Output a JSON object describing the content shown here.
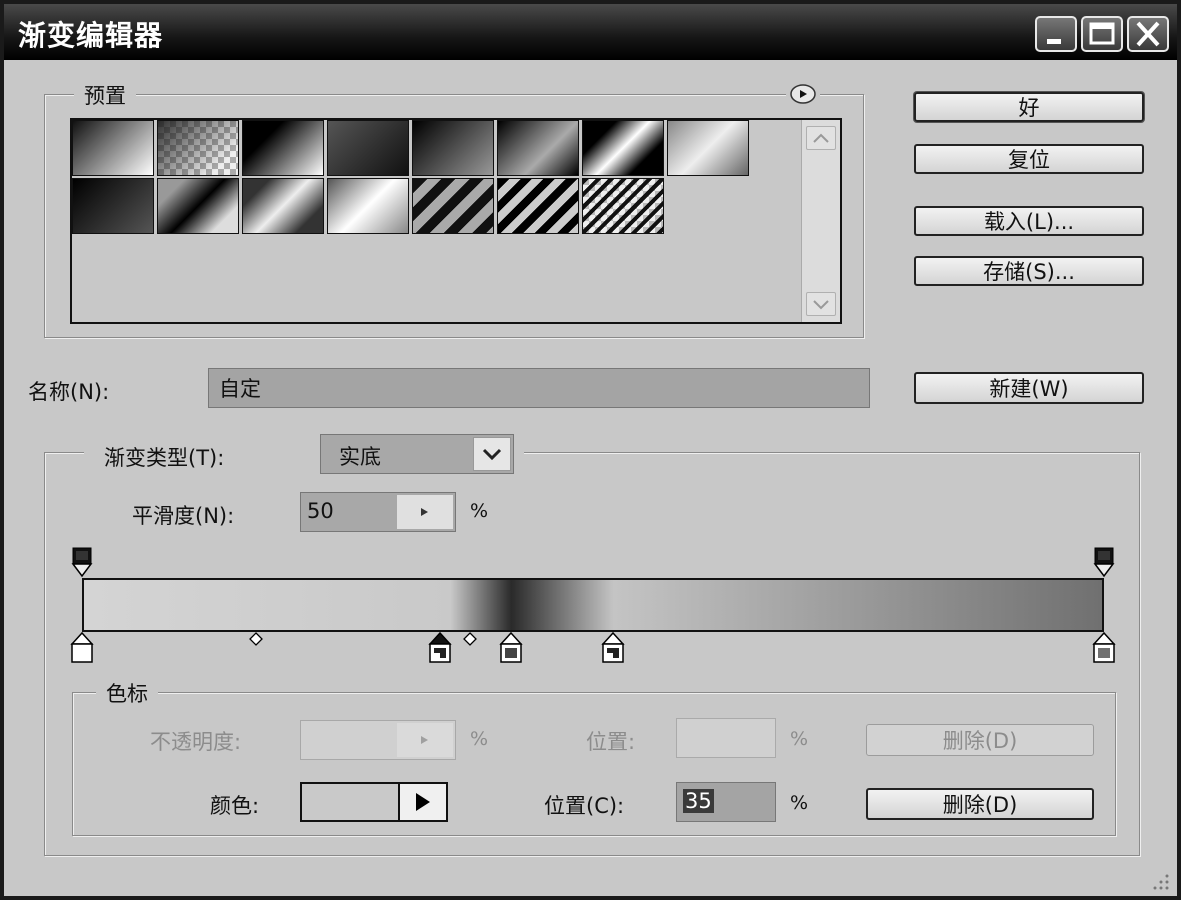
{
  "window": {
    "title": "渐变编辑器",
    "minimize_label": "minimize",
    "maximize_label": "maximize",
    "close_label": "close"
  },
  "presets": {
    "legend": "预置",
    "menu_icon": "play-circle-icon",
    "swatches": [
      {
        "row": 0,
        "col": 0,
        "style": "linear-gradient(135deg,#111 0%,#fff 100%)"
      },
      {
        "row": 0,
        "col": 1,
        "style": "checker"
      },
      {
        "row": 0,
        "col": 2,
        "style": "linear-gradient(135deg,#000 30%,#fff 100%)"
      },
      {
        "row": 0,
        "col": 3,
        "style": "linear-gradient(135deg,#555 0%,#111 100%)"
      },
      {
        "row": 0,
        "col": 4,
        "style": "linear-gradient(135deg,#000 0%,#999 100%)"
      },
      {
        "row": 0,
        "col": 5,
        "style": "linear-gradient(135deg,#000 0%,#aaa 60%,#000 100%)"
      },
      {
        "row": 0,
        "col": 6,
        "style": "linear-gradient(135deg,#000 25%,#fff 50%,#000 75%)"
      },
      {
        "row": 0,
        "col": 7,
        "style": "linear-gradient(135deg,#888 0%,#eee 50%,#666 100%)"
      },
      {
        "row": 1,
        "col": 0,
        "style": "linear-gradient(135deg,#000 0%,#555 100%)"
      },
      {
        "row": 1,
        "col": 1,
        "style": "linear-gradient(135deg,#999 20%,#000 50%,#ddd 80%)"
      },
      {
        "row": 1,
        "col": 2,
        "style": "linear-gradient(135deg,#333 20%,#eee 50%,#333 80%)"
      },
      {
        "row": 1,
        "col": 3,
        "style": "linear-gradient(135deg,#555 0%,#fff 50%,#888 100%)"
      },
      {
        "row": 1,
        "col": 4,
        "style": "repeating-linear-gradient(135deg,#111 0 10px,#aaa 10px 20px)"
      },
      {
        "row": 1,
        "col": 5,
        "style": "repeating-linear-gradient(135deg,#000 0 8px,#ccc 8px 16px)"
      },
      {
        "row": 1,
        "col": 6,
        "style": "stripes"
      }
    ],
    "scroll_up_icon": "chevron-up-icon",
    "scroll_down_icon": "chevron-down-icon"
  },
  "buttons": {
    "ok": "好",
    "reset": "复位",
    "load": "载入(L)...",
    "save": "存储(S)...",
    "new": "新建(W)"
  },
  "name_field": {
    "label": "名称(N):",
    "value": "自定"
  },
  "gradient": {
    "type_label": "渐变类型(T):",
    "type_value": "实底",
    "smooth_label": "平滑度(N):",
    "smooth_value": "50",
    "percent": "%",
    "bar_colors": [
      "#d4d4d4",
      "#c9c9c9",
      "#2a2a2a",
      "#c4c4c4",
      "#707070"
    ],
    "color_stop_positions": [
      0,
      35,
      42,
      52,
      100
    ],
    "opacity_stop_positions": [
      0,
      100
    ],
    "midpoint_positions": [
      17,
      38
    ]
  },
  "stops": {
    "legend": "色标",
    "opacity_label": "不透明度:",
    "opacity_value": "",
    "opacity_percent": "%",
    "location_label_1": "位置:",
    "location_value_1": "",
    "location_percent_1": "%",
    "delete_label_1": "删除(D)",
    "color_label": "颜色:",
    "location_label_2": "位置(C):",
    "location_value_2": "35",
    "location_percent_2": "%",
    "delete_label_2": "删除(D)"
  }
}
